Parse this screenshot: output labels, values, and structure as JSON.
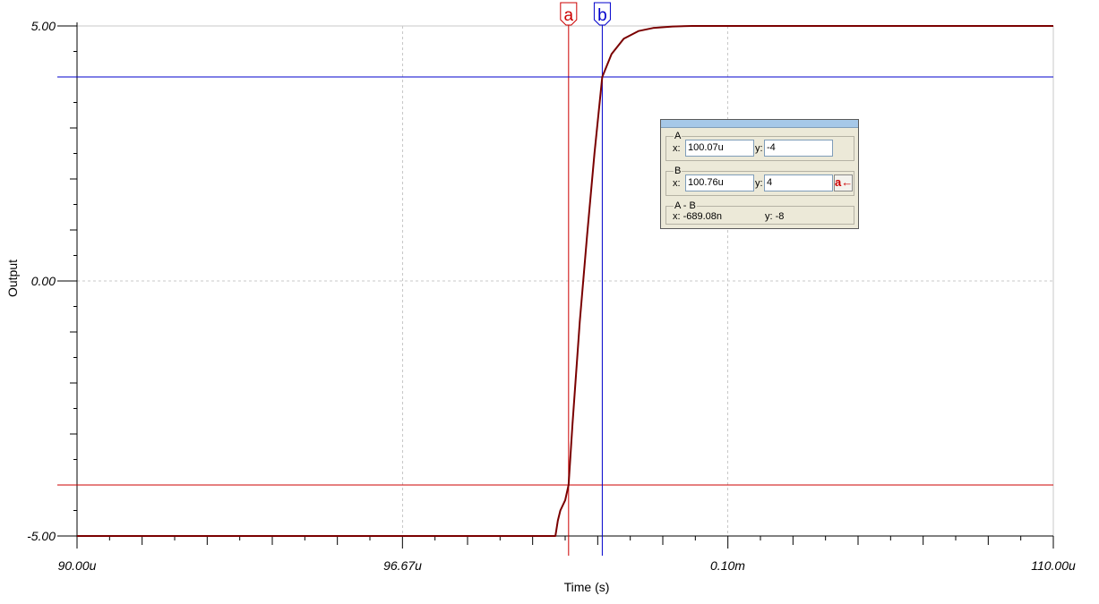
{
  "chart_data": {
    "type": "line",
    "xlabel": "Time (s)",
    "ylabel": "Output",
    "xlim": [
      90,
      110
    ],
    "ylim": [
      -5,
      5
    ],
    "x_ticks": [
      {
        "value": 90.0,
        "label": "90.00u"
      },
      {
        "value": 96.67,
        "label": "96.67u"
      },
      {
        "value": 103.33,
        "label": "0.10m"
      },
      {
        "value": 110.0,
        "label": "110.00u"
      }
    ],
    "y_ticks": [
      {
        "value": 5,
        "label": "5.00"
      },
      {
        "value": 0,
        "label": "0.00"
      },
      {
        "value": -5,
        "label": "-5.00"
      }
    ],
    "series": [
      {
        "color": "#7a0000",
        "x": [
          90,
          99.8,
          99.85,
          99.9,
          100.0,
          100.07,
          100.15,
          100.3,
          100.45,
          100.6,
          100.76,
          100.95,
          101.2,
          101.5,
          101.8,
          102.2,
          102.6,
          103.33,
          105,
          110
        ],
        "y": [
          -5,
          -5,
          -4.7,
          -4.5,
          -4.3,
          -4.0,
          -2.8,
          -0.8,
          0.9,
          2.5,
          4.0,
          4.45,
          4.75,
          4.9,
          4.96,
          4.99,
          5.0,
          5.0,
          5.0,
          5.0
        ]
      }
    ],
    "cursors": [
      {
        "name": "a",
        "x": 100.07,
        "y": -4,
        "color": "#cc0000"
      },
      {
        "name": "b",
        "x": 100.76,
        "y": 4,
        "color": "#0000cc"
      }
    ],
    "grid": true
  },
  "cursor_panel": {
    "a_group": "A",
    "a_x_label": "x:",
    "a_x": "100.07u",
    "a_y_label": "y:",
    "a_y": "-4",
    "b_group": "B",
    "b_x_label": "x:",
    "b_x": "100.76u",
    "b_y_label": "y:",
    "b_y": "4",
    "swap_label": "a←",
    "diff_group": "A - B",
    "diff_x": "x:  -689.08n",
    "diff_y": "y: -8"
  }
}
